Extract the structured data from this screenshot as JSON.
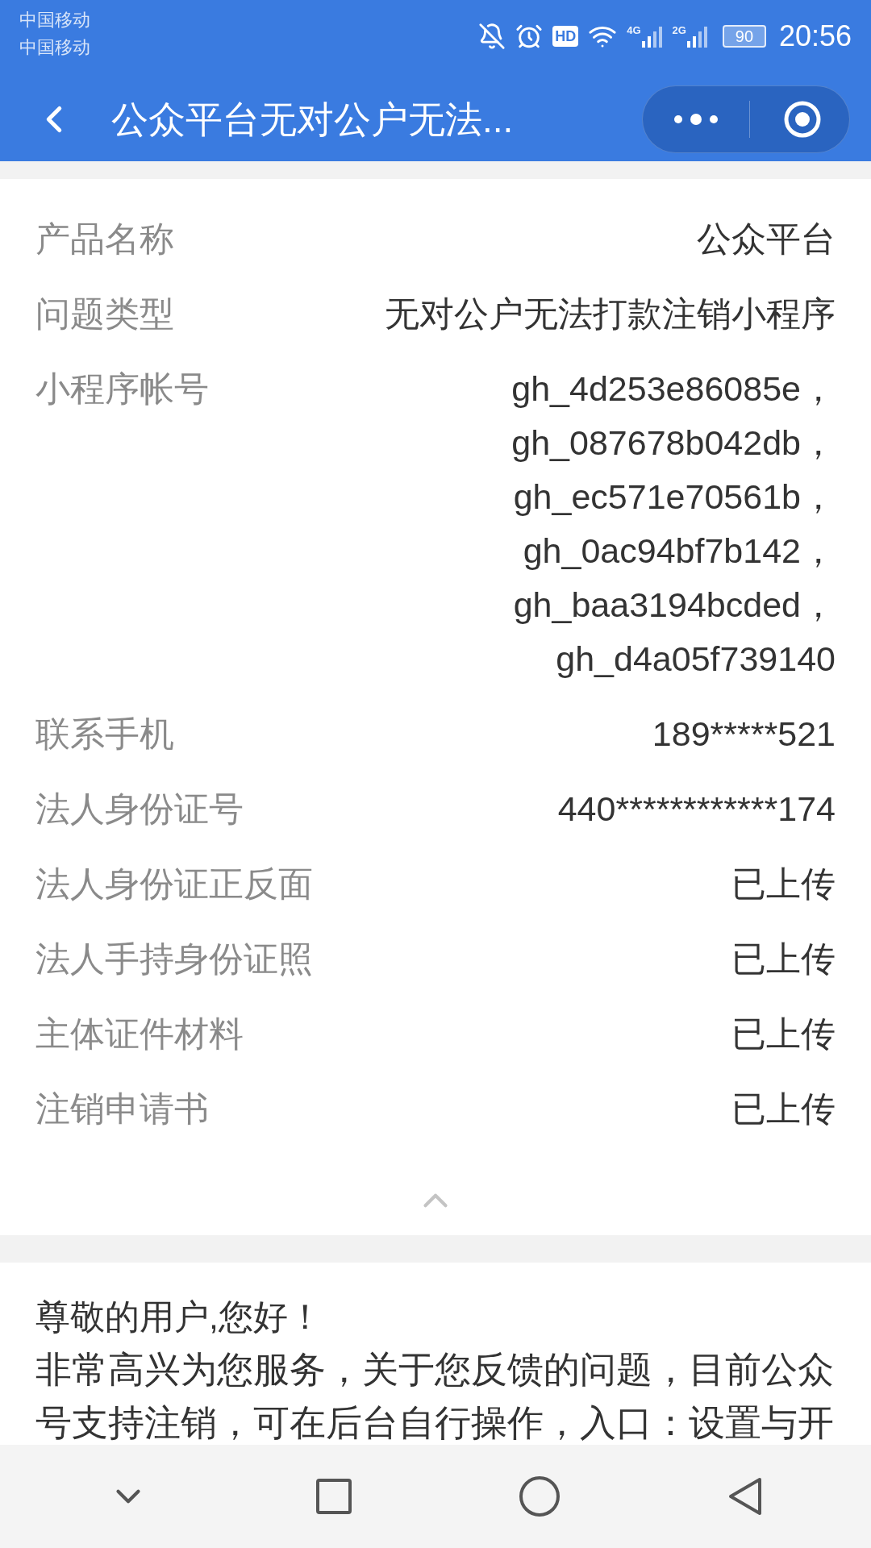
{
  "status_bar": {
    "carriers": [
      "中国移动",
      "中国移动"
    ],
    "hd": "HD",
    "networks": [
      "4G",
      "2G"
    ],
    "battery": "90",
    "time": "20:56"
  },
  "header": {
    "title": "公众平台无对公户无法..."
  },
  "details": [
    {
      "label": "产品名称",
      "values": [
        "公众平台"
      ]
    },
    {
      "label": "问题类型",
      "values": [
        "无对公户无法打款注销小程序"
      ]
    },
    {
      "label": "小程序帐号",
      "values": [
        "gh_4d253e86085e，",
        "gh_087678b042db，",
        "gh_ec571e70561b，",
        "gh_0ac94bf7b142，",
        "gh_baa3194bcded，",
        "gh_d4a05f739140"
      ]
    },
    {
      "label": "联系手机",
      "values": [
        "189*****521"
      ]
    },
    {
      "label": "法人身份证号",
      "values": [
        "440************174"
      ]
    },
    {
      "label": "法人身份证正反面",
      "values": [
        "已上传"
      ]
    },
    {
      "label": "法人手持身份证照",
      "values": [
        "已上传"
      ]
    },
    {
      "label": "主体证件材料",
      "values": [
        "已上传"
      ]
    },
    {
      "label": "注销申请书",
      "values": [
        "已上传"
      ]
    }
  ],
  "reply": {
    "greeting": "尊敬的用户,您好！",
    "body": "非常高兴为您服务，关于您反馈的问题，目前公众号支持注销，可在后台自行操作，入口：设置与开"
  }
}
